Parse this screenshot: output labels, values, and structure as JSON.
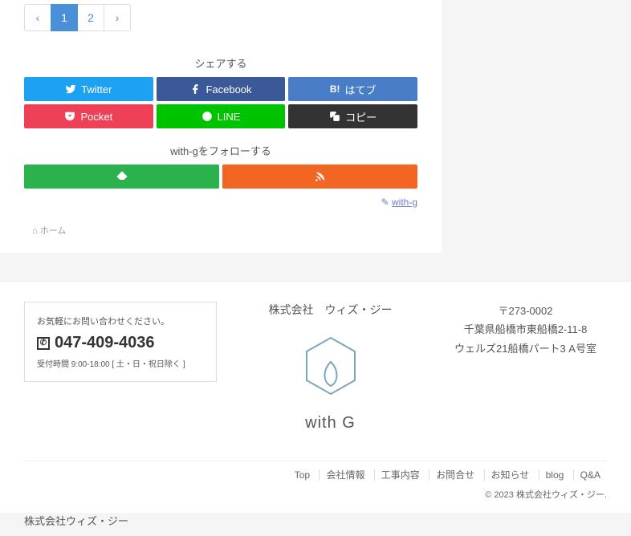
{
  "pagination": {
    "prev": "‹",
    "p1": "1",
    "p2": "2",
    "next": "›"
  },
  "share": {
    "title": "シェアする",
    "twitter": "Twitter",
    "facebook": "Facebook",
    "hatena": "はてブ",
    "pocket": "Pocket",
    "line": "LINE",
    "copy": "コピー"
  },
  "follow": {
    "title": "with-gをフォローする"
  },
  "profile": {
    "text": "with-g"
  },
  "breadcrumb": {
    "home": "ホーム"
  },
  "contact": {
    "lead": "お気軽にお問い合わせください。",
    "phone": "047-409-4036",
    "hours": "受付時間 9:00-18:00 [ 土・日・祝日除く ]"
  },
  "company": {
    "name": "株式会社　ウィズ・ジー",
    "logo_text": "with G"
  },
  "address": {
    "postal": "〒273-0002",
    "line1": "千葉県船橋市東船橋2-11-8",
    "line2": "ウェルズ21船橋パート3 A号室"
  },
  "nav": {
    "top": "Top",
    "company": "会社情報",
    "work": "工事内容",
    "contact": "お問合せ",
    "news": "お知らせ",
    "blog": "blog",
    "qa": "Q&A"
  },
  "copyright": "© 2023 株式会社ウィズ・ジー.",
  "site_title": "株式会社ウィズ・ジー"
}
